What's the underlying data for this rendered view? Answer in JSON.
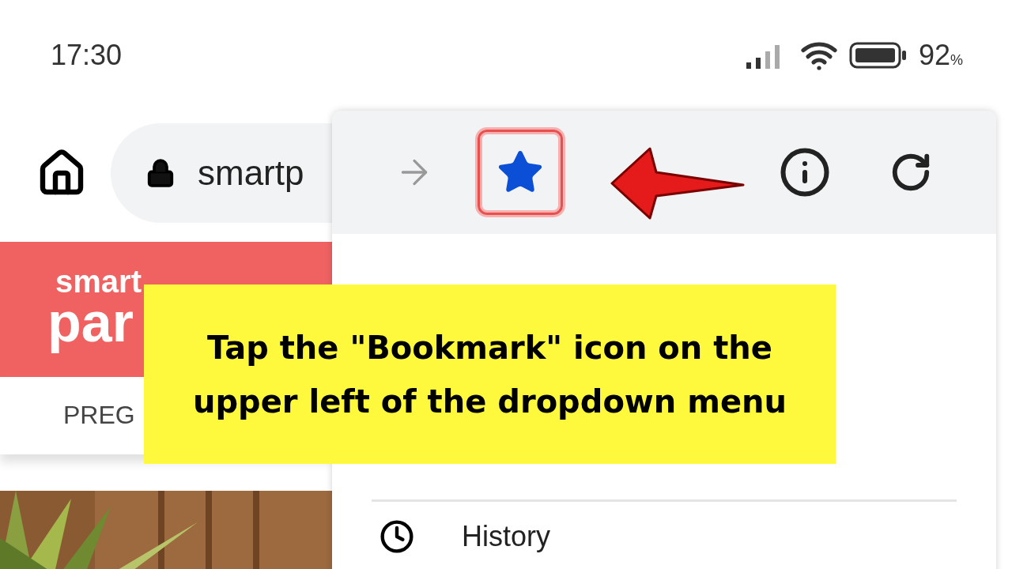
{
  "status_bar": {
    "time": "17:30",
    "battery": "92",
    "battery_unit": "%"
  },
  "toolbar": {
    "url": "smartp"
  },
  "page": {
    "logo_top": "smart",
    "logo_bottom": "par",
    "nav_item": "PREG"
  },
  "menu": {
    "actions": [
      {
        "kind": "forward",
        "disabled": true,
        "highlighted": false
      },
      {
        "kind": "bookmark",
        "disabled": false,
        "highlighted": true
      },
      {
        "kind": "info",
        "disabled": false,
        "highlighted": false
      },
      {
        "kind": "refresh",
        "disabled": false,
        "highlighted": false
      }
    ],
    "items": [
      {
        "kind": "history",
        "label": "History"
      }
    ]
  },
  "callout": {
    "text": "Tap the \"Bookmark\" icon on the upper left of the dropdown menu"
  }
}
